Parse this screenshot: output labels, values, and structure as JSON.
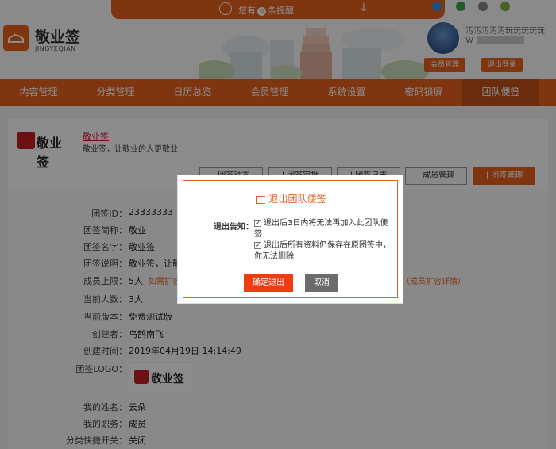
{
  "header": {
    "notice": {
      "prefix": "您有",
      "count": "0",
      "suffix": "条提醒"
    },
    "logo": {
      "title": "敬业签",
      "subtitle": "JINGYEQIAN"
    },
    "user": {
      "name": "汚汚汚汚汚玩玩玩玩玩",
      "id_prefix": "W"
    },
    "buttons": {
      "member": "会员管理",
      "logout": "退出登录"
    }
  },
  "nav": {
    "items": [
      {
        "label": "内容管理"
      },
      {
        "label": "分类管理"
      },
      {
        "label": "日历总览"
      },
      {
        "label": "会员管理"
      },
      {
        "label": "系统设置"
      },
      {
        "label": "密码锁屏"
      },
      {
        "label": "团队便签"
      }
    ]
  },
  "team": {
    "brand_text": "敬业签",
    "link_title": "敬业签",
    "slogan": "敬业签，让敬业的人更敬业",
    "toolbar": {
      "btn1": "| 团签动态",
      "btn2": "| 团签审批",
      "btn3": "| 团签日志",
      "btn4": "| 成员管理",
      "btn5": "| 团签管理"
    },
    "fields": {
      "id_label": "团签ID：",
      "id_value": "23333333",
      "short_label": "团签简称：",
      "short_value": "敬业",
      "name_label": "团签名字：",
      "name_value": "敬业签",
      "desc_label": "团签说明：",
      "desc_value": "敬业签，让敬",
      "limit_label": "成员上限：",
      "limit_value": "5人",
      "limit_link": "如需扩容",
      "limit_detail": "（成员扩容详情）",
      "count_label": "当前人数：",
      "count_value": "3人",
      "version_label": "当前版本：",
      "version_value": "免费测试版",
      "creator_label": "创建者：",
      "creator_value": "乌鹊南飞",
      "time_label": "创建时间：",
      "time_value": "2019年04月19日  14:14:49",
      "logo_label": "团签LOGO：",
      "logo_text": "敬业签",
      "myname_label": "我的姓名：",
      "myname_value": "云朵",
      "role_label": "我的职务：",
      "role_value": "成员",
      "shortcut_label": "分类快捷开关：",
      "shortcut_value": "关闭"
    }
  },
  "modal": {
    "title": "退出团队便签",
    "notice_label": "退出告知：",
    "check1": "退出后3日内将无法再加入此团队便签",
    "check2": "退出后所有资料仍保存在原团签中，你无法删除",
    "confirm": "确定退出",
    "cancel": "取消"
  }
}
